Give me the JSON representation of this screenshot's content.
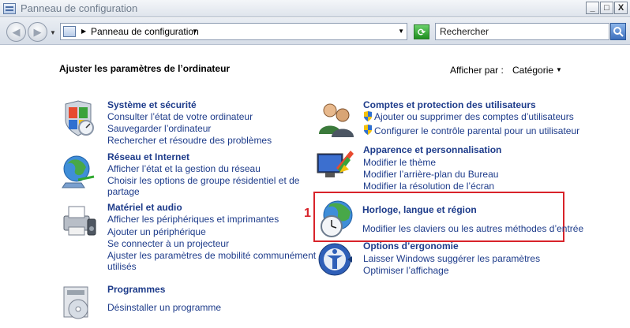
{
  "window": {
    "title": "Panneau de configuration",
    "minimize": "_",
    "maximize": "□",
    "close": "X"
  },
  "address": {
    "path": "Panneau de configuration",
    "search_placeholder": "Rechercher"
  },
  "page": {
    "heading": "Ajuster les paramètres de l’ordinateur",
    "view_label": "Afficher par :",
    "view_value": "Catégorie"
  },
  "categories": {
    "systeme": {
      "title": "Système et sécurité",
      "links": [
        "Consulter l’état de votre ordinateur",
        "Sauvegarder l’ordinateur",
        "Rechercher et résoudre des problèmes"
      ]
    },
    "reseau": {
      "title": "Réseau et Internet",
      "links": [
        "Afficher l’état et la gestion du réseau",
        "Choisir les options de groupe résidentiel et de",
        "partage"
      ]
    },
    "materiel": {
      "title": "Matériel et audio",
      "links": [
        "Afficher les périphériques et imprimantes",
        "Ajouter un périphérique",
        "Se connecter à un projecteur",
        "Ajuster les paramètres de mobilité communément",
        "utilisés"
      ]
    },
    "programmes": {
      "title": "Programmes",
      "links": [
        "Désinstaller un programme"
      ]
    },
    "comptes": {
      "title": "Comptes et protection des utilisateurs",
      "links": [
        "Ajouter ou supprimer des comptes d’utilisateurs",
        "Configurer le contrôle parental pour un utilisateur"
      ]
    },
    "apparence": {
      "title": "Apparence et personnalisation",
      "links": [
        "Modifier le thème",
        "Modifier l’arrière-plan du Bureau",
        "Modifier la résolution de l’écran"
      ]
    },
    "horloge": {
      "title": "Horloge, langue et région",
      "links": [
        "Modifier les claviers ou les autres méthodes d’entrée"
      ]
    },
    "ergonomie": {
      "title": "Options d’ergonomie",
      "links": [
        "Laisser Windows suggérer les paramètres",
        "Optimiser l’affichage"
      ]
    }
  },
  "annotation": {
    "marker": "1"
  }
}
